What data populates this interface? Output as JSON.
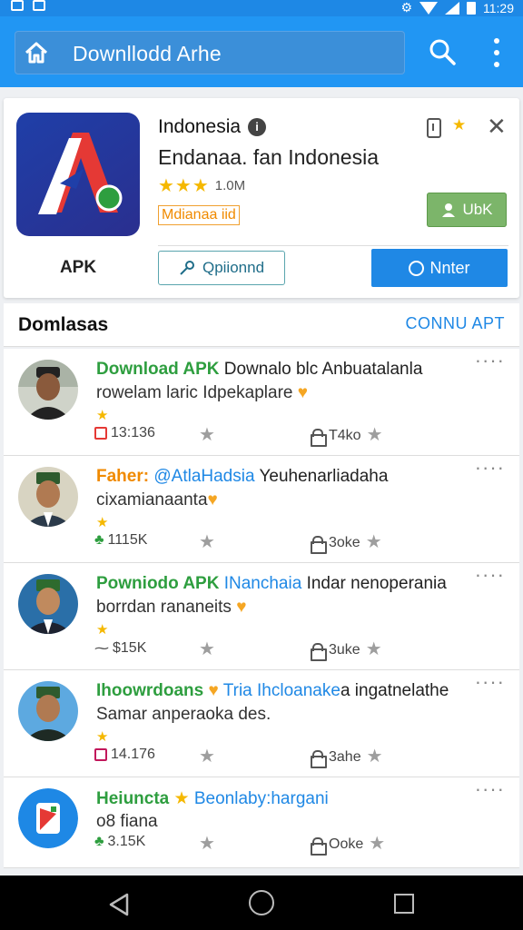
{
  "status": {
    "time": "11:29"
  },
  "appbar": {
    "title": "Downllodd Arhe"
  },
  "featured": {
    "title": "Indonesia",
    "subtitle": "Endanaa. fan Indonesia",
    "rating_stars": 3,
    "rating_count": "1.0M",
    "tag": "Mdianaa iid",
    "apk_label": "APK",
    "ubk_label": "UbK",
    "optional_label": "Qpiionnd",
    "install_label": "Nnter"
  },
  "section": {
    "title": "Domlasas",
    "link": "CONNU APT"
  },
  "items": [
    {
      "highlight": "Download APK",
      "highlight_color": "green",
      "rest": " Downalo blc Anbuatalanla",
      "line2": "rowelam laric Idpekaplare",
      "downloads": "13:136",
      "size": "T4ko",
      "stat_icon": "cart"
    },
    {
      "highlight": "Faher: ",
      "highlight_color": "orange",
      "blue": "@AtlaHadsia",
      "rest": " Yeuhenarliadaha",
      "line2": "cixamianaanta",
      "downloads": "1115K",
      "size": "3oke",
      "stat_icon": "leaf"
    },
    {
      "highlight": "Powniodo APK",
      "highlight_color": "green",
      "blue": " INanchaia",
      "rest": " Indar nenoperania",
      "line2": "borrdan rananeits",
      "downloads": "$15K",
      "size": "3uke",
      "stat_icon": "wave"
    },
    {
      "highlight": "Ihoowrdoans",
      "highlight_color": "green",
      "blue": " Tria Ihcloanake",
      "rest": "a ingatnelathe",
      "line2": "Samar anperaoka des.",
      "downloads": "14.176",
      "size": "3ahe",
      "stat_icon": "cart"
    },
    {
      "highlight": "Heiuncta",
      "highlight_color": "green",
      "blue": " Beonlaby:hargani",
      "rest": "",
      "line2": "o8 fiana",
      "downloads": "3.15K",
      "size": "Ooke",
      "stat_icon": "leaf"
    }
  ],
  "colors": {
    "primary": "#2196f3",
    "accent": "#1f88e5",
    "star": "#f5b800",
    "green": "#2e9e3f"
  }
}
